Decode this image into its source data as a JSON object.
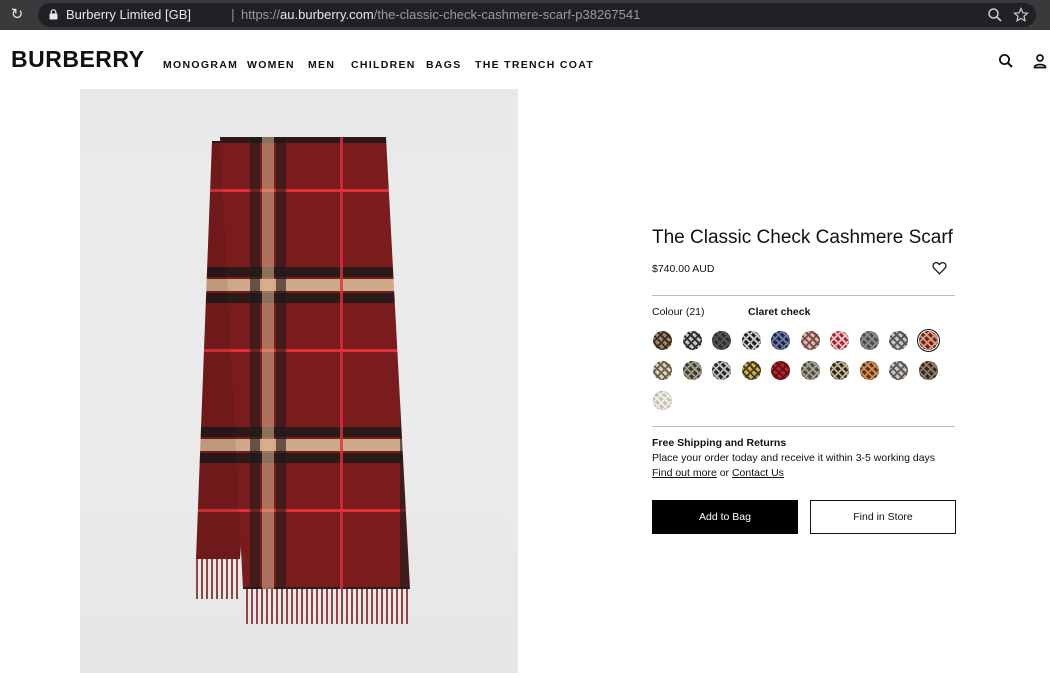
{
  "browser": {
    "site_identity": "Burberry Limited [GB]",
    "url_scheme": "https://",
    "url_host": "au.burberry.com",
    "url_path": "/the-classic-check-cashmere-scarf-p38267541",
    "separator": "|"
  },
  "header": {
    "logo": "BURBERRY",
    "nav": [
      "MONOGRAM",
      "WOMEN",
      "MEN",
      "CHILDREN",
      "BAGS",
      "THE TRENCH COAT"
    ]
  },
  "product": {
    "title": "The Classic Check Cashmere Scarf",
    "price": "$740.00 AUD",
    "colour_label": "Colour (21)",
    "colour_selected": "Claret check",
    "swatches": [
      {
        "base": "#a3876b",
        "stripe": "#3a2d24",
        "selected": false
      },
      {
        "base": "#c9c5c1",
        "stripe": "#2d2d2d",
        "selected": false
      },
      {
        "base": "#2c2c2c",
        "stripe": "#555555",
        "selected": false
      },
      {
        "base": "#1f1f22",
        "stripe": "#c9c9c9",
        "selected": false
      },
      {
        "base": "#1b2447",
        "stripe": "#6e7aa6",
        "selected": false
      },
      {
        "base": "#d9b9b4",
        "stripe": "#7a4a46",
        "selected": false
      },
      {
        "base": "#b51d2a",
        "stripe": "#e6c8c8",
        "selected": false
      },
      {
        "base": "#4d4d4f",
        "stripe": "#8c8c8c",
        "selected": false
      },
      {
        "base": "#c8c6c3",
        "stripe": "#555555",
        "selected": false
      },
      {
        "base": "#6b1f20",
        "stripe": "#d69f7c",
        "selected": true
      },
      {
        "base": "#ddd3c1",
        "stripe": "#6d5d4a",
        "selected": false
      },
      {
        "base": "#3b3a2f",
        "stripe": "#a49f86",
        "selected": false
      },
      {
        "base": "#232323",
        "stripe": "#bdbdbd",
        "selected": false
      },
      {
        "base": "#d9b52e",
        "stripe": "#3a3a3a",
        "selected": false
      },
      {
        "base": "#bf1f2c",
        "stripe": "#5a1215",
        "selected": false
      },
      {
        "base": "#4c4b44",
        "stripe": "#a7a18f",
        "selected": false
      },
      {
        "base": "#2a2722",
        "stripe": "#c2b38f",
        "selected": false
      },
      {
        "base": "#5b3320",
        "stripe": "#d38f4f",
        "selected": false
      },
      {
        "base": "#ccc4ba",
        "stripe": "#5d5a55",
        "selected": false
      },
      {
        "base": "#2d2a25",
        "stripe": "#8f7a62",
        "selected": false
      },
      {
        "base": "#ccc2b2",
        "stripe": "#eeeeee",
        "selected": false
      }
    ],
    "shipping_heading": "Free Shipping and Returns",
    "shipping_text": "Place your order today and receive it within 3-5 working days",
    "find_out_more": "Find out more",
    "or_text": "or",
    "contact_us": "Contact Us",
    "add_to_bag": "Add to Bag",
    "find_in_store": "Find in Store"
  }
}
